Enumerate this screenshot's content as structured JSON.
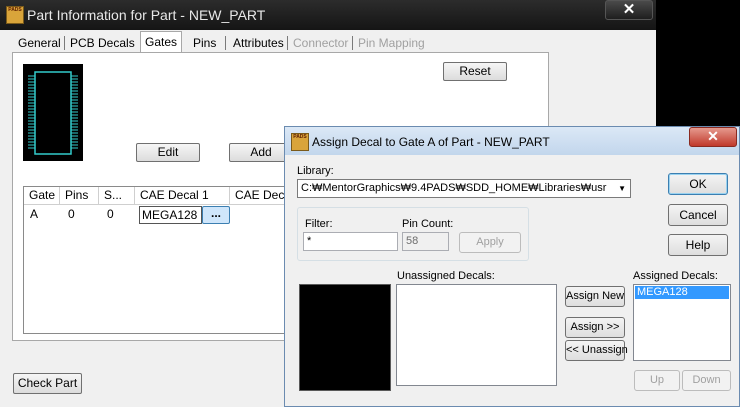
{
  "part_window": {
    "title": "Part Information for Part - NEW_PART",
    "app_icon_text": "PADS",
    "close_glyph": "✕",
    "tabs": [
      {
        "label": "General",
        "state": "normal"
      },
      {
        "label": "PCB Decals",
        "state": "normal"
      },
      {
        "label": "Gates",
        "state": "active"
      },
      {
        "label": "Pins",
        "state": "normal"
      },
      {
        "label": "Attributes",
        "state": "normal"
      },
      {
        "label": "Connector",
        "state": "disabled"
      },
      {
        "label": "Pin Mapping",
        "state": "disabled"
      }
    ],
    "reset_label": "Reset",
    "edit_label": "Edit",
    "add_label": "Add",
    "gates_table": {
      "headers": [
        "Gate",
        "Pins",
        "S...",
        "CAE Decal 1",
        "CAE Decal 2"
      ],
      "rows": [
        {
          "gate": "A",
          "pins": "0",
          "swap": "0",
          "cae_decal_1": "MEGA128",
          "browse": "..."
        }
      ]
    },
    "check_part_label": "Check Part"
  },
  "assign_dialog": {
    "title": "Assign Decal to Gate A of Part - NEW_PART",
    "close_glyph": "✕",
    "library_label": "Library:",
    "library_value": "C:₩MentorGraphics₩9.4PADS₩SDD_HOME₩Libraries₩usr",
    "filter_label": "Filter:",
    "filter_value": "*",
    "pin_count_label": "Pin Count:",
    "pin_count_value": "58",
    "apply_label": "Apply",
    "unassigned_label": "Unassigned Decals:",
    "unassigned_items": [],
    "assigned_label": "Assigned Decals:",
    "assigned_items": [
      "MEGA128"
    ],
    "assign_new_label": "Assign New",
    "assign_label": "Assign >>",
    "unassign_label": "<< Unassign",
    "ok_label": "OK",
    "cancel_label": "Cancel",
    "help_label": "Help",
    "up_label": "Up",
    "down_label": "Down"
  }
}
